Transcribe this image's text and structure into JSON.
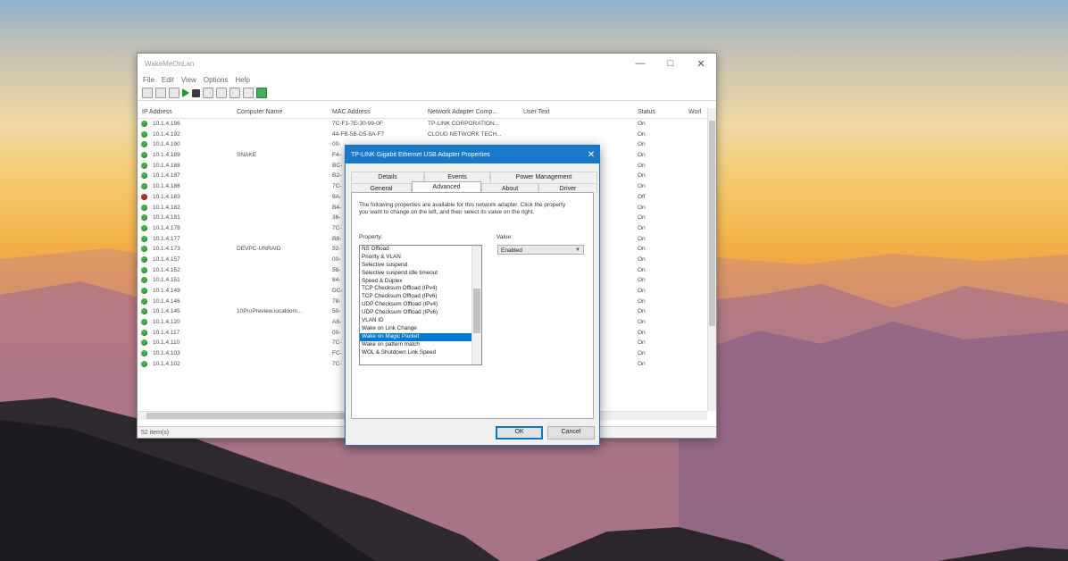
{
  "main_window": {
    "title": "WakeMeOnLan",
    "menu": [
      "File",
      "Edit",
      "View",
      "Options",
      "Help"
    ],
    "columns": [
      "IP Address",
      "Computer Name",
      "MAC Address",
      "Network Adapter Comp...",
      "User Text",
      "Status",
      "Worl"
    ],
    "rows": [
      {
        "ip": "10.1.4.196",
        "name": "",
        "mac": "7C-F1-7E-30-99-0F",
        "adapter": "TP-LINK CORPORATION...",
        "status": "On",
        "online": true
      },
      {
        "ip": "10.1.4.192",
        "name": "",
        "mac": "44-FB-5B-D5-8A-F7",
        "adapter": "CLOUD NETWORK TECH...",
        "status": "On",
        "online": true
      },
      {
        "ip": "10.1.4.190",
        "name": "",
        "mac": "00-",
        "adapter": "",
        "status": "On",
        "online": true
      },
      {
        "ip": "10.1.4.189",
        "name": "SNAKE",
        "mac": "F4-",
        "adapter": "",
        "status": "On",
        "online": true
      },
      {
        "ip": "10.1.4.188",
        "name": "",
        "mac": "BC-",
        "adapter": "",
        "status": "On",
        "online": true
      },
      {
        "ip": "10.1.4.187",
        "name": "",
        "mac": "B2-",
        "adapter": "",
        "status": "On",
        "online": true
      },
      {
        "ip": "10.1.4.186",
        "name": "",
        "mac": "7C-",
        "adapter": "",
        "status": "On",
        "online": true
      },
      {
        "ip": "10.1.4.183",
        "name": "",
        "mac": "9A-",
        "adapter": "",
        "status": "Off",
        "online": false
      },
      {
        "ip": "10.1.4.182",
        "name": "",
        "mac": "B4-",
        "adapter": "",
        "status": "On",
        "online": true
      },
      {
        "ip": "10.1.4.181",
        "name": "",
        "mac": "36-",
        "adapter": "",
        "status": "On",
        "online": true
      },
      {
        "ip": "10.1.4.178",
        "name": "",
        "mac": "7C-",
        "adapter": "",
        "status": "On",
        "online": true
      },
      {
        "ip": "10.1.4.177",
        "name": "",
        "mac": "B8-",
        "adapter": "",
        "status": "On",
        "online": true
      },
      {
        "ip": "10.1.4.173",
        "name": "DEVPC-UNRAID",
        "mac": "52-",
        "adapter": "",
        "status": "On",
        "online": true
      },
      {
        "ip": "10.1.4.157",
        "name": "",
        "mac": "00-",
        "adapter": "",
        "status": "On",
        "online": true
      },
      {
        "ip": "10.1.4.152",
        "name": "",
        "mac": "58-",
        "adapter": "",
        "status": "On",
        "online": true
      },
      {
        "ip": "10.1.4.151",
        "name": "",
        "mac": "84-",
        "adapter": "",
        "status": "On",
        "online": true
      },
      {
        "ip": "10.1.4.149",
        "name": "",
        "mac": "DC-",
        "adapter": "",
        "status": "On",
        "online": true
      },
      {
        "ip": "10.1.4.146",
        "name": "",
        "mac": "78-",
        "adapter": "",
        "status": "On",
        "online": true
      },
      {
        "ip": "10.1.4.145",
        "name": "10ProPreview.localdom...",
        "mac": "50-",
        "adapter": "",
        "status": "On",
        "online": true
      },
      {
        "ip": "10.1.4.120",
        "name": "",
        "mac": "A8-",
        "adapter": "",
        "status": "On",
        "online": true
      },
      {
        "ip": "10.1.4.117",
        "name": "",
        "mac": "00-",
        "adapter": "",
        "status": "On",
        "online": true
      },
      {
        "ip": "10.1.4.110",
        "name": "",
        "mac": "7C-",
        "adapter": "",
        "status": "On",
        "online": true
      },
      {
        "ip": "10.1.4.103",
        "name": "",
        "mac": "FC-",
        "adapter": "",
        "status": "On",
        "online": true
      },
      {
        "ip": "10.1.4.102",
        "name": "",
        "mac": "7C-",
        "adapter": "",
        "status": "On",
        "online": true
      }
    ],
    "status_bar": "52 item(s)"
  },
  "dialog": {
    "title": "TP-LINK Gigabit Ethernet USB Adapter Properties",
    "tabs_top": [
      "Details",
      "Events",
      "Power Management"
    ],
    "tabs_bottom": [
      "General",
      "Advanced",
      "About",
      "Driver"
    ],
    "active_tab": "Advanced",
    "description": "The following properties are available for this network adapter. Click the property you want to change on the left, and then select its value on the right.",
    "property_label": "Property:",
    "value_label": "Value:",
    "properties": [
      "NS Offload",
      "Priority & VLAN",
      "Selective suspend",
      "Selective suspend idle timeout",
      "Speed & Duplex",
      "TCP Checksum Offload (IPv4)",
      "TCP Checksum Offload (IPv6)",
      "UDP Checksum Offload (IPv4)",
      "UDP Checksum Offload (IPv6)",
      "VLAN ID",
      "Wake on Link Change",
      "Wake on Magic Packet",
      "Wake on pattern match",
      "WOL & Shutdown Link Speed"
    ],
    "selected_property": "Wake on Magic Packet",
    "value": "Enabled",
    "ok_label": "OK",
    "cancel_label": "Cancel"
  },
  "colors": {
    "accent": "#1979ca",
    "online": "#3cb446",
    "offline": "#c22a2a"
  }
}
